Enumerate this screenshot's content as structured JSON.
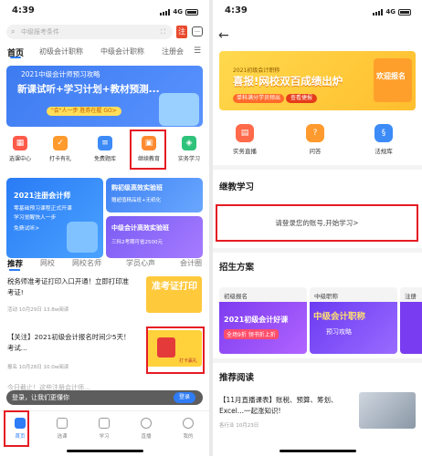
{
  "left": {
    "status": {
      "time": "4:39",
      "network": "4G"
    },
    "search": {
      "placeholder": "中级报考条件"
    },
    "tabs": [
      "首页",
      "初级会计职称",
      "中级会计职称",
      "注册会"
    ],
    "banner": {
      "top": "2021中级会计师预习攻略",
      "main": "新课试听+学习计划+教材预测...",
      "pill": "\"会\"人一步 胜券在握 GO>"
    },
    "icons": [
      {
        "label": "选课中心",
        "icon": "course-icon",
        "color": "#ff5a4a"
      },
      {
        "label": "打卡有礼",
        "icon": "checkin-icon",
        "color": "#ff9a2e"
      },
      {
        "label": "免费题库",
        "icon": "question-bank-icon",
        "color": "#3c8bf7"
      },
      {
        "label": "继续教育",
        "icon": "education-icon",
        "color": "#ff8a30"
      },
      {
        "label": "实务学习",
        "icon": "practice-icon",
        "color": "#2fc27a"
      }
    ],
    "cards": {
      "left": {
        "title": "2021注册会计师",
        "line1": "零基础预习课程正式开课",
        "line2": "学习觉醒快人一步",
        "pill": "免费试听>"
      },
      "right1": {
        "title": "购初级高效实验班",
        "sub": "赠超值精品班+无纸化"
      },
      "right2": {
        "title": "中级会计高效实验班",
        "sub": "三科2考期可省2500元"
      }
    },
    "subtabs": [
      "推荐",
      "网校",
      "网校名师",
      "学员心声",
      "会计圈"
    ],
    "news": [
      {
        "title": "税务师准考证打印入口开通！立即打印准考证!",
        "source": "活动",
        "date": "10月29日",
        "views": "13.8w阅读",
        "thumb": "准考证打印"
      },
      {
        "title": "【关注】2021初级会计报名时间少5天！考试...",
        "source": "报名",
        "date": "10月28日",
        "views": "10.0w阅读",
        "thumb": "打卡赢礼"
      }
    ],
    "dialog": {
      "text": "登录，让我们更懂你",
      "button": "登录",
      "behind": "今日截止！这些注册会计师..."
    },
    "nav": [
      "首页",
      "选课",
      "学习",
      "直播",
      "我的"
    ]
  },
  "right": {
    "status": {
      "time": "4:39",
      "network": "4G"
    },
    "banner": {
      "sub": "2021初级会计职称",
      "title": "喜报!网校双百成绩出炉",
      "pill1": "单科满分学员频出",
      "pill2": "查看捷报",
      "badge": "欢迎报名"
    },
    "services": [
      {
        "label": "实务直播",
        "icon": "live-icon",
        "color": "#ff6a4a"
      },
      {
        "label": "问答",
        "icon": "qa-icon",
        "color": "#ff9a2e"
      },
      {
        "label": "法规库",
        "icon": "law-icon",
        "color": "#3c8bf7"
      }
    ],
    "continue": {
      "heading": "继教学习",
      "login": "请登录您的账号,开始学习>"
    },
    "plans": {
      "heading": "招生方案",
      "items": [
        {
          "head": "初级报名",
          "img": "2021初级会计好课",
          "sub": "全场9折 领书折上折"
        },
        {
          "head": "中级职称",
          "img": "中级会计职称",
          "sub": "预习攻略"
        },
        {
          "head": "注册",
          "img": "",
          "sub": ""
        }
      ]
    },
    "reading": {
      "heading": "推荐阅读",
      "title": "【11月直播课表】账税、预算、筹划、Excel...一起涨知识!",
      "source": "各行业",
      "date": "10月23日"
    }
  }
}
